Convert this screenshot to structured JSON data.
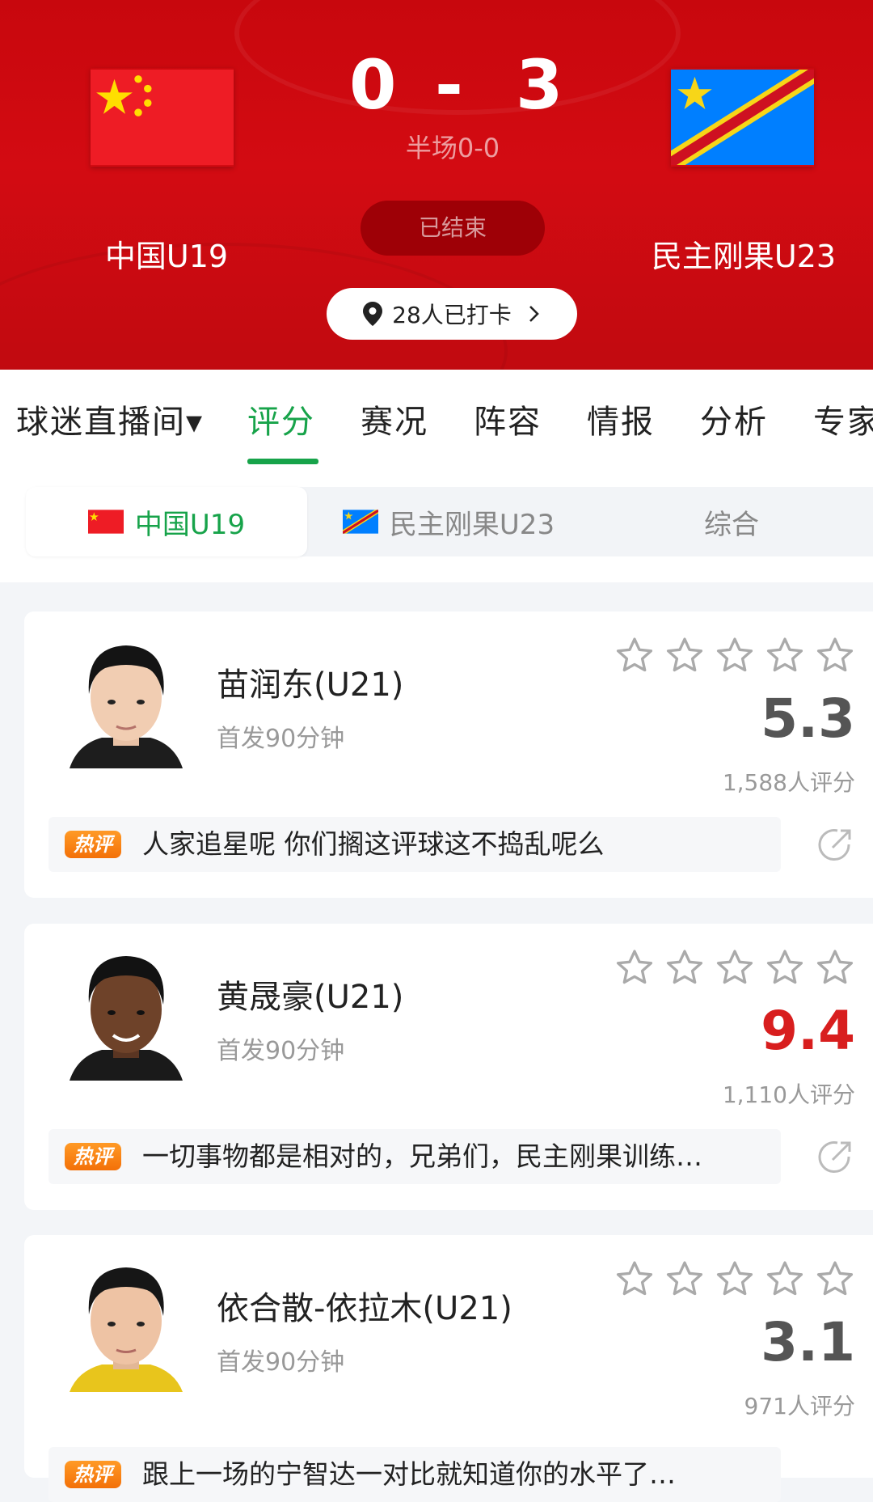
{
  "match": {
    "home_team": "中国U19",
    "away_team": "民主刚果U23",
    "home_score": "0",
    "score_separator": "-",
    "away_score": "3",
    "halftime": "半场0-0",
    "status": "已结束",
    "checkin": "28人已打卡"
  },
  "tabs": [
    {
      "label": "球迷直播间▾"
    },
    {
      "label": "评分",
      "active": true
    },
    {
      "label": "赛况"
    },
    {
      "label": "阵容"
    },
    {
      "label": "情报"
    },
    {
      "label": "分析"
    },
    {
      "label": "专家"
    }
  ],
  "team_selector": [
    {
      "label": "中国U19",
      "active": true
    },
    {
      "label": "民主刚果U23"
    },
    {
      "label": "综合"
    }
  ],
  "hot_badge_label": "热评",
  "players": [
    {
      "name": "苗润东(U21)",
      "minutes": "首发90分钟",
      "rating": "5.3",
      "votes": "1,588人评分",
      "comment": "人家追星呢 你们搁这评球这不捣乱呢么"
    },
    {
      "name": "黄晟豪(U21)",
      "minutes": "首发90分钟",
      "rating": "9.4",
      "votes": "1,110人评分",
      "comment": "一切事物都是相对的，兄弟们，民主刚果训练…"
    },
    {
      "name": "依合散-依拉木(U21)",
      "minutes": "首发90分钟",
      "rating": "3.1",
      "votes": "971人评分",
      "comment": "跟上一场的宁智达一对比就知道你的水平了…"
    }
  ],
  "colors": {
    "header_red": "#c8070d",
    "accent_green": "#17a34a",
    "high_rating_red": "#d81e1e",
    "hot_badge_orange": "#f37008"
  }
}
